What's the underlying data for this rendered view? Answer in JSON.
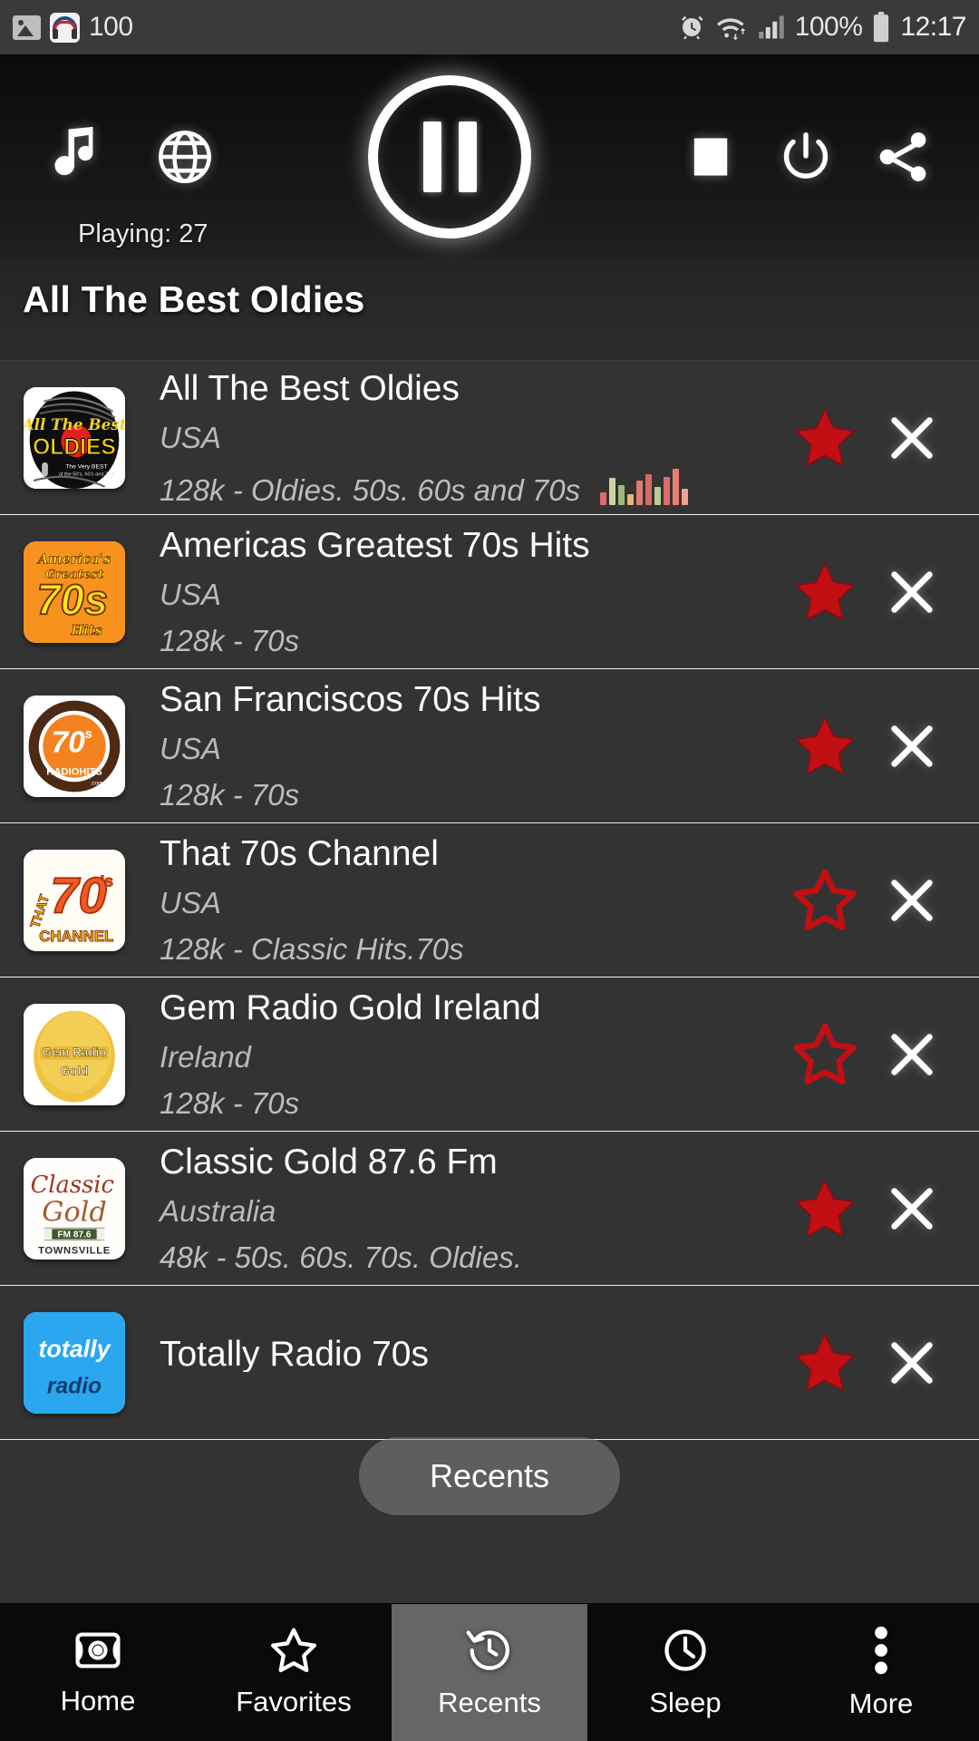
{
  "status_bar": {
    "left_icons": [
      "image-icon",
      "nonstop-music-app-icon"
    ],
    "notification_count": "100",
    "right_icons": [
      "alarm-icon",
      "wifi-icon",
      "signal-icon",
      "battery-icon"
    ],
    "battery_percent": "100%",
    "time": "12:17"
  },
  "player": {
    "music_icon": "music-note-icon",
    "globe_icon": "globe-icon",
    "play_pause_icon": "pause-icon",
    "stop_icon": "stop-icon",
    "power_icon": "power-icon",
    "share_icon": "share-icon",
    "playing_label": "Playing: 27"
  },
  "now_playing": {
    "title": "All The Best Oldies"
  },
  "stations": [
    {
      "name": "All The Best Oldies",
      "country": "USA",
      "description": "128k - Oldies. 50s. 60s and 70s",
      "favorite": true,
      "playing": true,
      "logo": "all-the-best-oldies-logo"
    },
    {
      "name": "Americas Greatest 70s Hits",
      "country": "USA",
      "description": "128k - 70s",
      "favorite": true,
      "playing": false,
      "logo": "americas-greatest-70s-hits-logo"
    },
    {
      "name": "San Franciscos 70s Hits",
      "country": "USA",
      "description": "128k - 70s",
      "favorite": true,
      "playing": false,
      "logo": "san-franciscos-70s-hits-logo"
    },
    {
      "name": "That 70s Channel",
      "country": "USA",
      "description": "128k - Classic Hits.70s",
      "favorite": false,
      "playing": false,
      "logo": "that-70s-channel-logo"
    },
    {
      "name": "Gem Radio Gold Ireland",
      "country": "Ireland",
      "description": "128k - 70s",
      "favorite": false,
      "playing": false,
      "logo": "gem-radio-gold-logo"
    },
    {
      "name": "Classic Gold 87.6 Fm",
      "country": "Australia",
      "description": "48k - 50s. 60s. 70s. Oldies.",
      "favorite": true,
      "playing": false,
      "logo": "classic-gold-logo"
    },
    {
      "name": "Totally Radio 70s",
      "country": "",
      "description": "",
      "favorite": true,
      "playing": false,
      "logo": "totally-radio-logo"
    }
  ],
  "toast": {
    "text": "Recents"
  },
  "bottom_nav": {
    "active": "Recents",
    "items": [
      {
        "label": "Home",
        "icon": "radio-icon"
      },
      {
        "label": "Favorites",
        "icon": "star-outline-icon"
      },
      {
        "label": "Recents",
        "icon": "history-clock-icon"
      },
      {
        "label": "Sleep",
        "icon": "clock-icon"
      },
      {
        "label": "More",
        "icon": "overflow-dots-icon"
      }
    ]
  },
  "colors": {
    "background": "#333333",
    "favorite_star": "#c10f14",
    "nav_active": "#666666",
    "text_primary": "#ffffff",
    "text_secondary": "#bdbdbd"
  }
}
